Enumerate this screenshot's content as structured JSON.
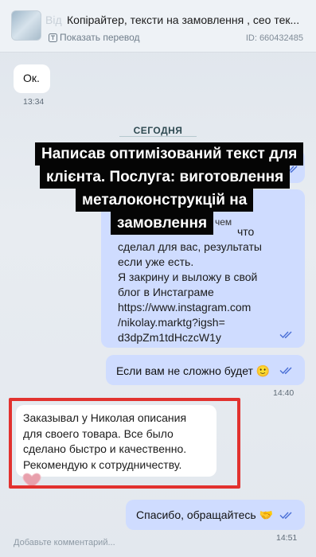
{
  "header": {
    "name_fragment": "Від",
    "title": "Копірайтер, тексти на замовлення , сео тек...",
    "translate_label": "Показать перевод",
    "chat_id": "ID: 660432485"
  },
  "messages": {
    "ok": {
      "text": "Ок.",
      "time": "13:34"
    },
    "date_separator": "СЕГОДНЯ",
    "long_message": {
      "partial_line": "чем",
      "lines": [
        "что",
        "сделал для вас, результаты",
        "если уже есть.",
        "Я закрину и выложу в свой",
        "блог в Инстаграме",
        "https://www.instagram.com",
        "/nikolay.marktg?igsh=",
        "d3dpZm1tdHczcW1y"
      ]
    },
    "request": {
      "text": "Если вам не сложно будет 🙂",
      "time": "14:40"
    },
    "review": {
      "lines": [
        "Заказывал у Николая описания",
        "для своего товара. Все было",
        "сделано быстро и качественно.",
        "Рекомендую к сотрудничеству."
      ],
      "reaction": "heart"
    },
    "thanks": {
      "text": "Спасибо, обращайтесь 🤝",
      "time": "14:51"
    }
  },
  "caption": {
    "lines": [
      "Написав оптимізований текст для",
      "клієнта. Послуга: виготовлення",
      "металоконструкцій на",
      "замовлення"
    ]
  },
  "footer": {
    "comment_placeholder": "Добавьте комментарий..."
  },
  "colors": {
    "incoming_bubble": "#ffffff",
    "outgoing_bubble": "#cfdcff",
    "tick": "#4a6fd6",
    "highlight": "#e2322f",
    "caption_bg": "#050505"
  },
  "icons": [
    "translate-icon",
    "double-check-icon",
    "heart-icon"
  ]
}
